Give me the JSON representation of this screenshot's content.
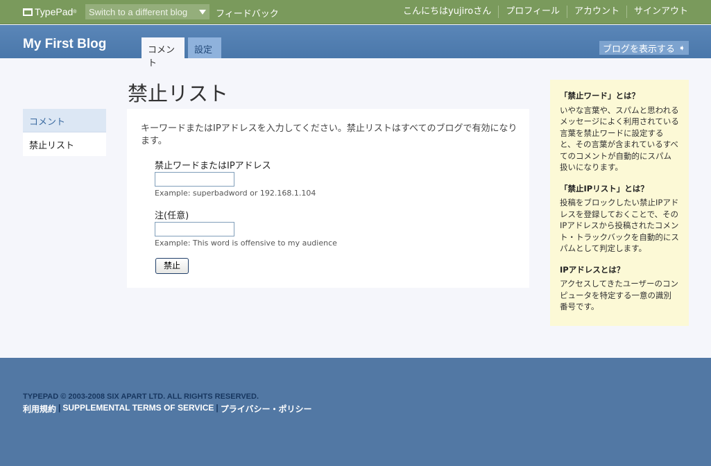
{
  "topbar": {
    "logo": "TypePad",
    "logo_mark": "®",
    "switch_blog": "Switch to a different blog",
    "feedback": "フィードバック",
    "greeting": "こんにちはyujiroさん",
    "profile": "プロフィール",
    "account": "アカウント",
    "signout": "サインアウト"
  },
  "blog": {
    "title": "My First Blog",
    "tabs": [
      {
        "label": "コメント"
      },
      {
        "label": "設定"
      }
    ],
    "view_blog": "ブログを表示する"
  },
  "sidebar": {
    "items": [
      {
        "label": "コメント"
      },
      {
        "label": "禁止リスト"
      }
    ]
  },
  "main": {
    "page_title": "禁止リスト",
    "intro": "キーワードまたはIPアドレスを入力してください。禁止リストはすべてのブログで有効になります。",
    "word_label": "禁止ワードまたはIPアドレス",
    "word_value": "",
    "word_example": "Example: superbadword or 192.168.1.104",
    "note_label": "注(任意)",
    "note_value": "",
    "note_example": "Example: This word is offensive to my audience",
    "ban_button": "禁止"
  },
  "help": {
    "sections": [
      {
        "title": "「禁止ワード」とは？",
        "body": "いやな言葉や、スパムと思われるメッセージによく利用されている言葉を禁止ワードに設定すると、その言葉が含まれているすべてのコメントが自動的にスパム扱いになります。"
      },
      {
        "title": "「禁止IPリスト」とは？",
        "body": "投稿をブロックしたい禁止IPアドレスを登録しておくことで、そのIPアドレスから投稿されたコメント・トラックバックを自動的にスパムとして判定します。"
      },
      {
        "title": "IPアドレスとは？",
        "body": "アクセスしてきたユーザーのコンピュータを特定する一意の識別番号です。"
      }
    ]
  },
  "footer": {
    "copyright": "TYPEPAD © 2003-2008 SIX APART LTD. ALL RIGHTS RESERVED.",
    "links": [
      {
        "label": "利用規約"
      },
      {
        "label": "SUPPLEMENTAL TERMS OF SERVICE"
      },
      {
        "label": "プライバシー・ポリシー"
      }
    ],
    "separator": "|"
  },
  "colors": {
    "topbar": "#7a9a5c",
    "blogbar": "#4a77aa",
    "footer": "#5278a4",
    "help_bg": "#fcf9d6"
  },
  "icons": {
    "logo": "typepad-logo-icon",
    "switch_caret": "chevron-down-icon",
    "view_blog_arrow": "arrow-right-icon"
  }
}
